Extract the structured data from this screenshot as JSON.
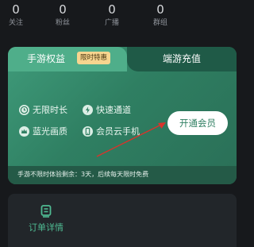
{
  "stats": [
    {
      "value": "0",
      "label": "关注"
    },
    {
      "value": "0",
      "label": "粉丝"
    },
    {
      "value": "0",
      "label": "广播"
    },
    {
      "value": "0",
      "label": "群组"
    }
  ],
  "membership_card": {
    "tab_mobile": "手游权益",
    "tab_mobile_badge": "限时特惠",
    "tab_pc": "端游充值",
    "features": [
      {
        "label": "无限时长",
        "icon": "clock-icon"
      },
      {
        "label": "快速通道",
        "icon": "lightning-icon"
      },
      {
        "label": "蓝光画质",
        "icon": "crown-icon"
      },
      {
        "label": "会员云手机",
        "icon": "phone-icon"
      }
    ],
    "open_button": "开通会员",
    "trial_notice": "手游不限时体验剩余：3天，后续每天限时免费"
  },
  "order_panel": {
    "label": "订单详情",
    "icon": "receipt-icon"
  },
  "colors": {
    "background": "#17191c",
    "card_green": "#2f7f62",
    "accent_green": "#4fba92",
    "badge_gold": "#f7d58f",
    "arrow_red": "#d9332b"
  }
}
